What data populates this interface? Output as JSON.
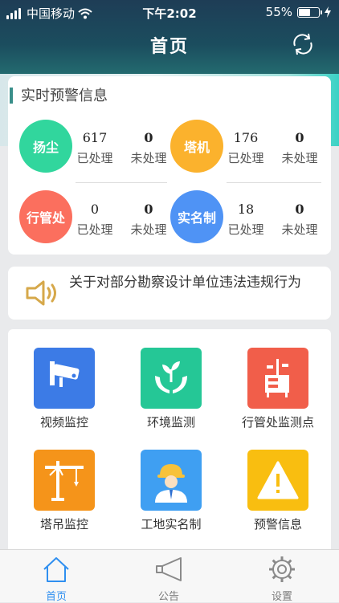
{
  "status": {
    "carrier": "中国移动",
    "time": "下午2:02",
    "battery": "55%"
  },
  "header": {
    "title": "首页"
  },
  "alert": {
    "title": "实时预警信息",
    "items": [
      {
        "name": "扬尘",
        "processed": "617",
        "processed_label": "已处理",
        "unprocessed": "0",
        "unprocessed_label": "未处理",
        "color": "#31d69d"
      },
      {
        "name": "塔机",
        "processed": "176",
        "processed_label": "已处理",
        "unprocessed": "0",
        "unprocessed_label": "未处理",
        "color": "#fbb22d"
      },
      {
        "name": "行管处",
        "processed": "0",
        "processed_label": "已处理",
        "unprocessed": "0",
        "unprocessed_label": "未处理",
        "color": "#fb6f5e"
      },
      {
        "name": "实名制",
        "processed": "18",
        "processed_label": "已处理",
        "unprocessed": "0",
        "unprocessed_label": "未处理",
        "color": "#4f93f5"
      }
    ]
  },
  "notice": {
    "text": "关于对部分勘察设计单位违法违规行为"
  },
  "grid": {
    "items": [
      {
        "label": "视频监控",
        "icon": "cctv-camera-icon",
        "color": "#3c7be6"
      },
      {
        "label": "环境监测",
        "icon": "plant-hands-icon",
        "color": "#25c796"
      },
      {
        "label": "行管处监测点",
        "icon": "monitoring-station-icon",
        "color": "#f15e4a"
      },
      {
        "label": "塔吊监控",
        "icon": "tower-crane-icon",
        "color": "#f5941a"
      },
      {
        "label": "工地实名制",
        "icon": "hardhat-worker-icon",
        "color": "#3f9ff2"
      },
      {
        "label": "预警信息",
        "icon": "warning-icon",
        "color": "#f9be10"
      }
    ]
  },
  "tabs": [
    {
      "label": "首页",
      "icon": "home-icon",
      "active": true
    },
    {
      "label": "公告",
      "icon": "megaphone-icon",
      "active": false
    },
    {
      "label": "设置",
      "icon": "gear-icon",
      "active": false
    }
  ]
}
